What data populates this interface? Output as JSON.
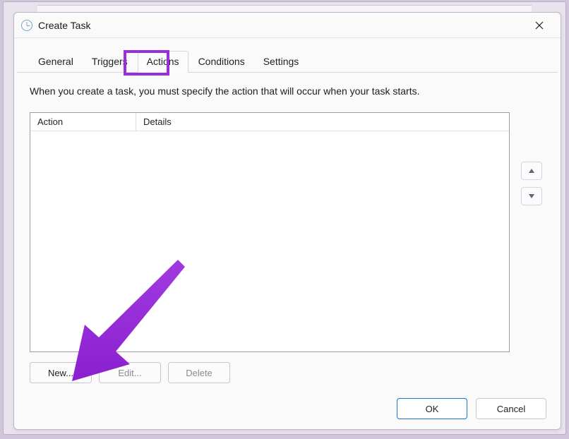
{
  "window": {
    "title": "Create Task"
  },
  "tabs": {
    "general": "General",
    "triggers": "Triggers",
    "actions": "Actions",
    "conditions": "Conditions",
    "settings": "Settings"
  },
  "description": "When you create a task, you must specify the action that will occur when your task starts.",
  "columns": {
    "action": "Action",
    "details": "Details"
  },
  "buttons": {
    "new": "New...",
    "edit": "Edit...",
    "delete": "Delete",
    "ok": "OK",
    "cancel": "Cancel"
  },
  "annotation": {
    "highlight_color": "#9a2fd9"
  }
}
